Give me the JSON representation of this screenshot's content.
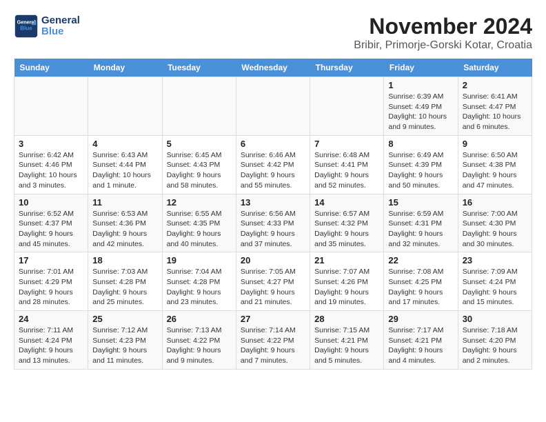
{
  "logo": {
    "text_general": "General",
    "text_blue": "Blue"
  },
  "title": "November 2024",
  "subtitle": "Bribir, Primorje-Gorski Kotar, Croatia",
  "days_of_week": [
    "Sunday",
    "Monday",
    "Tuesday",
    "Wednesday",
    "Thursday",
    "Friday",
    "Saturday"
  ],
  "weeks": [
    [
      {
        "num": "",
        "info": ""
      },
      {
        "num": "",
        "info": ""
      },
      {
        "num": "",
        "info": ""
      },
      {
        "num": "",
        "info": ""
      },
      {
        "num": "",
        "info": ""
      },
      {
        "num": "1",
        "info": "Sunrise: 6:39 AM\nSunset: 4:49 PM\nDaylight: 10 hours and 9 minutes."
      },
      {
        "num": "2",
        "info": "Sunrise: 6:41 AM\nSunset: 4:47 PM\nDaylight: 10 hours and 6 minutes."
      }
    ],
    [
      {
        "num": "3",
        "info": "Sunrise: 6:42 AM\nSunset: 4:46 PM\nDaylight: 10 hours and 3 minutes."
      },
      {
        "num": "4",
        "info": "Sunrise: 6:43 AM\nSunset: 4:44 PM\nDaylight: 10 hours and 1 minute."
      },
      {
        "num": "5",
        "info": "Sunrise: 6:45 AM\nSunset: 4:43 PM\nDaylight: 9 hours and 58 minutes."
      },
      {
        "num": "6",
        "info": "Sunrise: 6:46 AM\nSunset: 4:42 PM\nDaylight: 9 hours and 55 minutes."
      },
      {
        "num": "7",
        "info": "Sunrise: 6:48 AM\nSunset: 4:41 PM\nDaylight: 9 hours and 52 minutes."
      },
      {
        "num": "8",
        "info": "Sunrise: 6:49 AM\nSunset: 4:39 PM\nDaylight: 9 hours and 50 minutes."
      },
      {
        "num": "9",
        "info": "Sunrise: 6:50 AM\nSunset: 4:38 PM\nDaylight: 9 hours and 47 minutes."
      }
    ],
    [
      {
        "num": "10",
        "info": "Sunrise: 6:52 AM\nSunset: 4:37 PM\nDaylight: 9 hours and 45 minutes."
      },
      {
        "num": "11",
        "info": "Sunrise: 6:53 AM\nSunset: 4:36 PM\nDaylight: 9 hours and 42 minutes."
      },
      {
        "num": "12",
        "info": "Sunrise: 6:55 AM\nSunset: 4:35 PM\nDaylight: 9 hours and 40 minutes."
      },
      {
        "num": "13",
        "info": "Sunrise: 6:56 AM\nSunset: 4:33 PM\nDaylight: 9 hours and 37 minutes."
      },
      {
        "num": "14",
        "info": "Sunrise: 6:57 AM\nSunset: 4:32 PM\nDaylight: 9 hours and 35 minutes."
      },
      {
        "num": "15",
        "info": "Sunrise: 6:59 AM\nSunset: 4:31 PM\nDaylight: 9 hours and 32 minutes."
      },
      {
        "num": "16",
        "info": "Sunrise: 7:00 AM\nSunset: 4:30 PM\nDaylight: 9 hours and 30 minutes."
      }
    ],
    [
      {
        "num": "17",
        "info": "Sunrise: 7:01 AM\nSunset: 4:29 PM\nDaylight: 9 hours and 28 minutes."
      },
      {
        "num": "18",
        "info": "Sunrise: 7:03 AM\nSunset: 4:28 PM\nDaylight: 9 hours and 25 minutes."
      },
      {
        "num": "19",
        "info": "Sunrise: 7:04 AM\nSunset: 4:28 PM\nDaylight: 9 hours and 23 minutes."
      },
      {
        "num": "20",
        "info": "Sunrise: 7:05 AM\nSunset: 4:27 PM\nDaylight: 9 hours and 21 minutes."
      },
      {
        "num": "21",
        "info": "Sunrise: 7:07 AM\nSunset: 4:26 PM\nDaylight: 9 hours and 19 minutes."
      },
      {
        "num": "22",
        "info": "Sunrise: 7:08 AM\nSunset: 4:25 PM\nDaylight: 9 hours and 17 minutes."
      },
      {
        "num": "23",
        "info": "Sunrise: 7:09 AM\nSunset: 4:24 PM\nDaylight: 9 hours and 15 minutes."
      }
    ],
    [
      {
        "num": "24",
        "info": "Sunrise: 7:11 AM\nSunset: 4:24 PM\nDaylight: 9 hours and 13 minutes."
      },
      {
        "num": "25",
        "info": "Sunrise: 7:12 AM\nSunset: 4:23 PM\nDaylight: 9 hours and 11 minutes."
      },
      {
        "num": "26",
        "info": "Sunrise: 7:13 AM\nSunset: 4:22 PM\nDaylight: 9 hours and 9 minutes."
      },
      {
        "num": "27",
        "info": "Sunrise: 7:14 AM\nSunset: 4:22 PM\nDaylight: 9 hours and 7 minutes."
      },
      {
        "num": "28",
        "info": "Sunrise: 7:15 AM\nSunset: 4:21 PM\nDaylight: 9 hours and 5 minutes."
      },
      {
        "num": "29",
        "info": "Sunrise: 7:17 AM\nSunset: 4:21 PM\nDaylight: 9 hours and 4 minutes."
      },
      {
        "num": "30",
        "info": "Sunrise: 7:18 AM\nSunset: 4:20 PM\nDaylight: 9 hours and 2 minutes."
      }
    ]
  ]
}
